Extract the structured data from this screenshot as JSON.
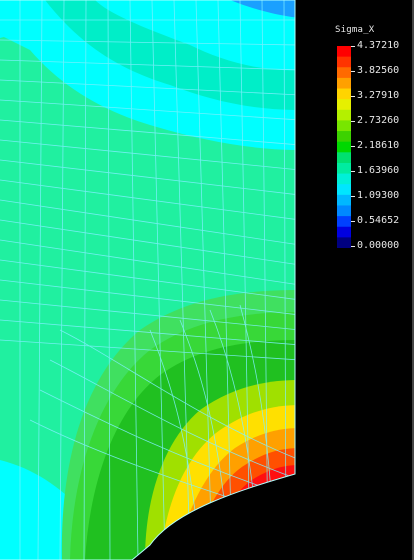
{
  "legend": {
    "title": "Sigma_X",
    "values": [
      "4.37210",
      "3.82560",
      "3.27910",
      "2.73260",
      "2.18610",
      "1.63960",
      "1.09300",
      "0.54652",
      "0.00000"
    ],
    "colors_top_to_bottom": [
      "#ff0000",
      "#ff3300",
      "#ff6a00",
      "#ffa000",
      "#ffd400",
      "#e6f000",
      "#b4f000",
      "#78e600",
      "#3cd200",
      "#00d800",
      "#00e070",
      "#00eca0",
      "#00f0d8",
      "#00e6ff",
      "#00b8ff",
      "#0088ff",
      "#0040ff",
      "#0000e0",
      "#000080"
    ]
  },
  "contour_colors": {
    "background": "#000000",
    "mesh": "#80f0ff",
    "blue_band": "#1aa0ff",
    "cyan": "#00ffff",
    "aqua": "#00eec8",
    "mint": "#20f0a0",
    "green_light": "#40e060",
    "green": "#38d838",
    "green_dark": "#20c020",
    "yellow_green": "#a0e000",
    "yellow": "#ffe000",
    "orange": "#ffa000",
    "red_orange": "#ff5000",
    "red": "#ff1010"
  }
}
